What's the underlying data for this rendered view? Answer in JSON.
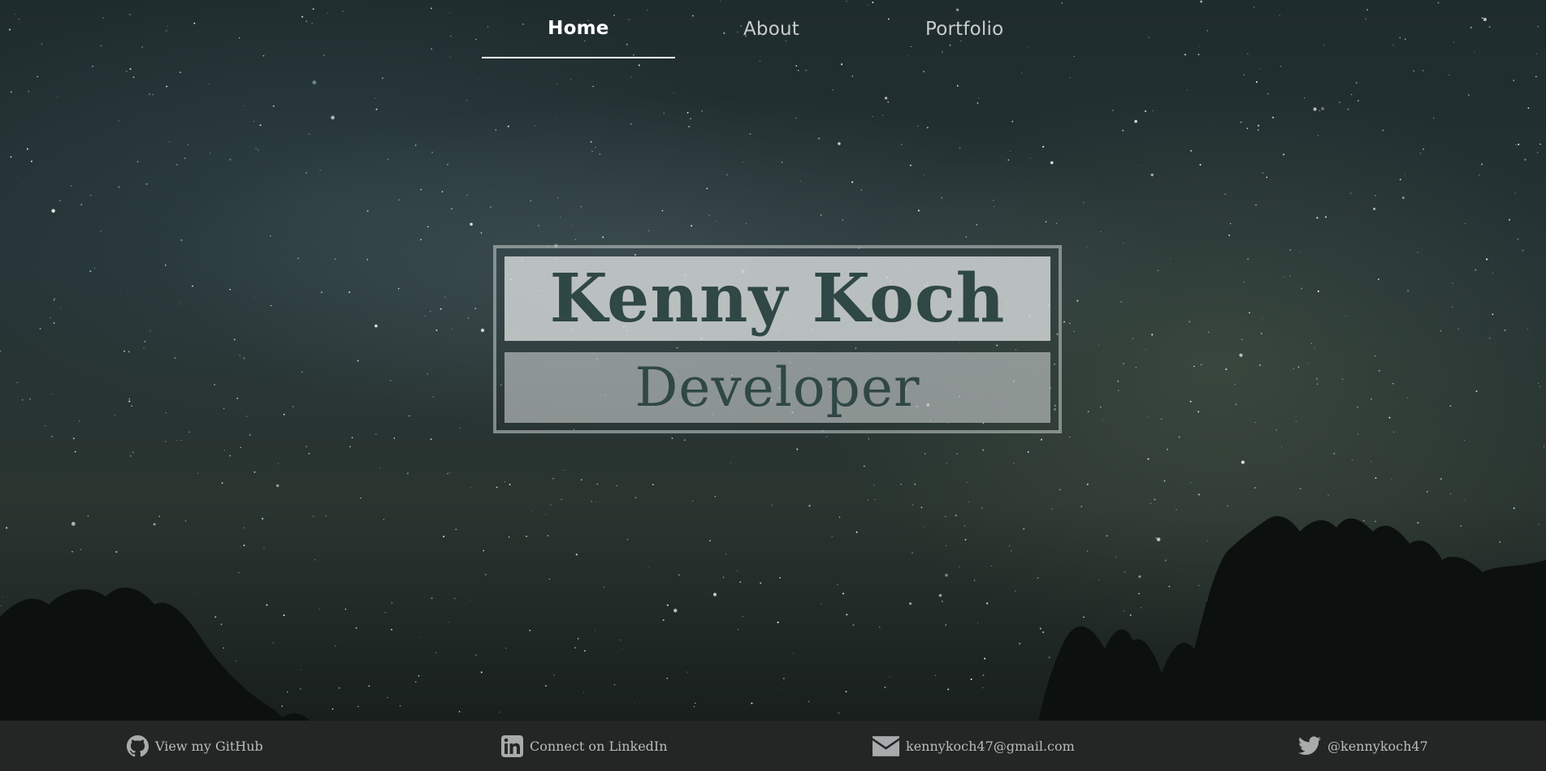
{
  "nav": {
    "items": [
      {
        "label": "Home",
        "active": true
      },
      {
        "label": "About",
        "active": false
      },
      {
        "label": "Portfolio",
        "active": false
      }
    ]
  },
  "hero": {
    "name": "Kenny Koch",
    "role": "Developer"
  },
  "footer": {
    "github": {
      "label": "View my GitHub",
      "icon": "github-icon"
    },
    "linkedin": {
      "label": "Connect on LinkedIn",
      "icon": "linkedin-icon"
    },
    "email": {
      "label": "kennykoch47@gmail.com",
      "icon": "envelope-icon"
    },
    "twitter": {
      "label": "@kennykoch47",
      "icon": "twitter-icon"
    }
  },
  "colors": {
    "title_text": "#2f4745",
    "footer_bg": "#242626",
    "nav_active": "#ffffff",
    "nav_inactive": "#c9cdcc"
  }
}
